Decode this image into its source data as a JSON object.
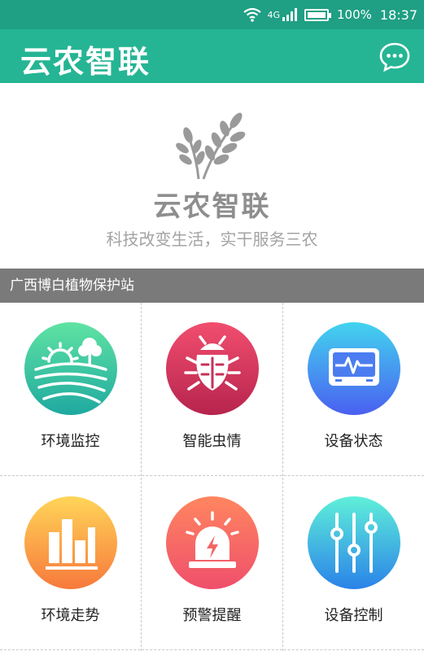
{
  "status_bar": {
    "network": "4G",
    "battery_percent": "100%",
    "battery_level": 1.0,
    "time": "18:37"
  },
  "app_bar": {
    "title": "云农智联",
    "message_icon": "chat-bubble-icon"
  },
  "hero": {
    "logo_icon": "wheat-icon",
    "name": "云农智联",
    "slogan": "科技改变生活，实干服务三农"
  },
  "station": {
    "name": "广西博白植物保护站"
  },
  "grid": {
    "items": [
      {
        "label": "环境监控",
        "icon": "farm-landscape-icon",
        "gradient": [
          "#5fe3a3",
          "#1fa9a0"
        ]
      },
      {
        "label": "智能虫情",
        "icon": "bug-icon",
        "gradient": [
          "#f24e6f",
          "#b6244d"
        ]
      },
      {
        "label": "设备状态",
        "icon": "monitor-pulse-icon",
        "gradient": [
          "#42d4ef",
          "#4a5ff0"
        ]
      },
      {
        "label": "环境走势",
        "icon": "bar-chart-icon",
        "gradient": [
          "#ffd558",
          "#f7793c"
        ]
      },
      {
        "label": "预警提醒",
        "icon": "alarm-light-icon",
        "gradient": [
          "#ff8660",
          "#ef4f6b"
        ]
      },
      {
        "label": "设备控制",
        "icon": "sliders-icon",
        "gradient": [
          "#5ff0d9",
          "#2a82e8"
        ]
      }
    ]
  }
}
